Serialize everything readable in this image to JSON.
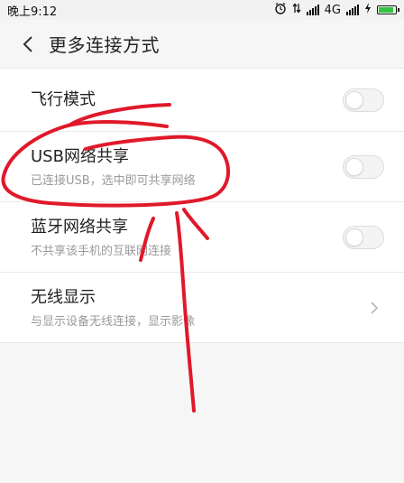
{
  "status_bar": {
    "time": "晚上9:12",
    "network": "4G",
    "alarm_icon": "alarm-icon",
    "signal_icon": "signal-icon",
    "battery_icon": "battery-icon",
    "battery_color": "#31c43f"
  },
  "header": {
    "title": "更多连接方式",
    "back_icon": "chevron-left-icon"
  },
  "settings": {
    "items": [
      {
        "title": "飞行模式",
        "subtitle": "",
        "control": "toggle",
        "on": false
      },
      {
        "title": "USB网络共享",
        "subtitle": "已连接USB，选中即可共享网络",
        "control": "toggle",
        "on": false
      },
      {
        "title": "蓝牙网络共享",
        "subtitle": "不共享该手机的互联网连接",
        "control": "toggle",
        "on": false
      },
      {
        "title": "无线显示",
        "subtitle": "与显示设备无线连接，显示影像",
        "control": "chevron"
      }
    ]
  },
  "colors": {
    "annotation": "#e0192a",
    "divider": "#e9e9e9",
    "subtitle": "#9a9a9a"
  }
}
